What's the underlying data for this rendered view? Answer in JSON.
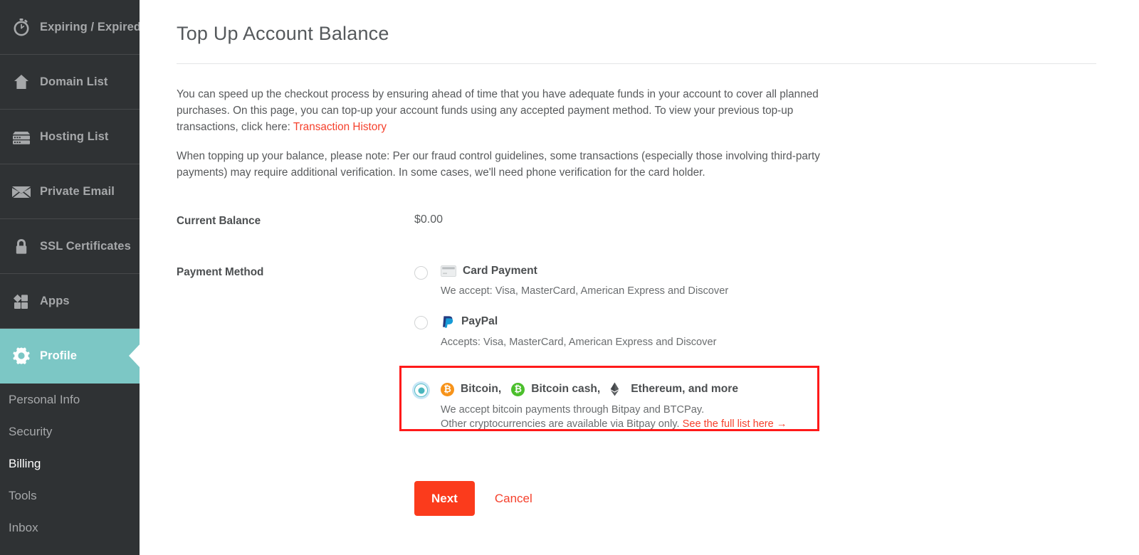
{
  "sidebar": {
    "items": [
      {
        "label": "Expiring / Expired",
        "icon": "stopwatch-icon",
        "active": false
      },
      {
        "label": "Domain List",
        "icon": "home-icon",
        "active": false
      },
      {
        "label": "Hosting List",
        "icon": "server-icon",
        "active": false
      },
      {
        "label": "Private Email",
        "icon": "envelope-icon",
        "active": false
      },
      {
        "label": "SSL Certificates",
        "icon": "lock-icon",
        "active": false
      },
      {
        "label": "Apps",
        "icon": "apps-icon",
        "active": false
      },
      {
        "label": "Profile",
        "icon": "gear-icon",
        "active": true
      }
    ],
    "sub_items": [
      {
        "label": "Personal Info",
        "current": false
      },
      {
        "label": "Security",
        "current": false
      },
      {
        "label": "Billing",
        "current": true
      },
      {
        "label": "Tools",
        "current": false
      },
      {
        "label": "Inbox",
        "current": false
      }
    ],
    "colors": {
      "background": "#2f3234",
      "active": "#7cc7c5",
      "text": "#a6a8aa"
    }
  },
  "page": {
    "title": "Top Up Account Balance",
    "intro_paragraph_1_before_link": "You can speed up the checkout process by ensuring ahead of time that you have adequate funds in your account to cover all planned purchases. On this page, you can top-up your account funds using any accepted payment method. To view your previous top-up transactions, click here: ",
    "intro_link_label": "Transaction History",
    "intro_paragraph_2": "When topping up your balance, please note: Per our fraud control guidelines, some transactions (especially those involving third-party payments) may require additional verification. In some cases, we'll need phone verification for the card holder."
  },
  "form": {
    "current_balance_label": "Current Balance",
    "current_balance_value": "$0.00",
    "payment_method_label": "Payment Method",
    "options": [
      {
        "id": "card",
        "title": "Card Payment",
        "icon": "credit-card-icon",
        "description": "We accept: Visa, MasterCard, American Express and Discover",
        "selected": false
      },
      {
        "id": "paypal",
        "title": "PayPal",
        "icon": "paypal-icon",
        "description": "Accepts: Visa, MasterCard, American Express and Discover",
        "selected": false
      },
      {
        "id": "crypto",
        "title_part_1": "Bitcoin,",
        "title_part_2": "Bitcoin cash,",
        "title_part_3": "Ethereum, and more",
        "icon_1": "bitcoin-icon",
        "icon_2": "bitcoin-cash-icon",
        "icon_3": "ethereum-icon",
        "description_line_1": "We accept bitcoin payments through Bitpay and BTCPay.",
        "description_line_2_before_link": "Other cryptocurrencies are available via Bitpay only. ",
        "description_link_label": "See the full list here →",
        "selected": true,
        "highlight_color": "#ff1a1a"
      }
    ]
  },
  "actions": {
    "next_label": "Next",
    "cancel_label": "Cancel",
    "next_color": "#fb3b1c",
    "cancel_color": "#f5402c"
  }
}
